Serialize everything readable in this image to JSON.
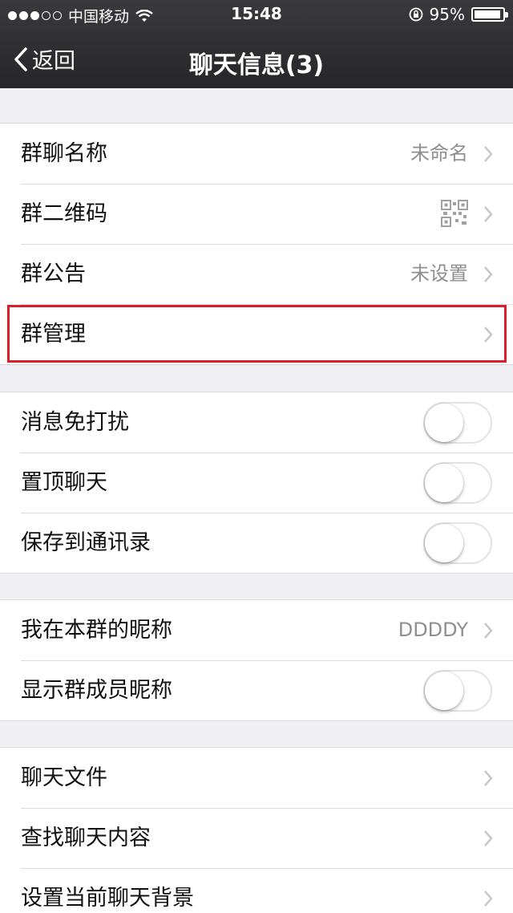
{
  "status_bar": {
    "carrier": "中国移动",
    "time": "15:48",
    "battery": "95%",
    "battery_level": 0.95,
    "signal_bars_filled": 3,
    "signal_bars_total": 5
  },
  "nav": {
    "back_label": "返回",
    "title": "聊天信息(3)"
  },
  "group1": [
    {
      "label": "群聊名称",
      "value": "未命名"
    },
    {
      "label": "群二维码",
      "value": "",
      "icon": "qr-code-icon"
    },
    {
      "label": "群公告",
      "value": "未设置"
    },
    {
      "label": "群管理",
      "value": ""
    }
  ],
  "group2": [
    {
      "label": "消息免打扰",
      "toggle": false
    },
    {
      "label": "置顶聊天",
      "toggle": false
    },
    {
      "label": "保存到通讯录",
      "toggle": false
    }
  ],
  "group3": [
    {
      "label": "我在本群的昵称",
      "value": "DDDDY"
    },
    {
      "label": "显示群成员昵称",
      "toggle": false
    }
  ],
  "group4": [
    {
      "label": "聊天文件"
    },
    {
      "label": "查找聊天内容"
    },
    {
      "label": "设置当前聊天背景"
    }
  ],
  "colors": {
    "nav_background": "#2d2d2f",
    "page_background": "#efeff4",
    "highlight": "#d9202a",
    "secondary_text": "#8e8e93"
  }
}
